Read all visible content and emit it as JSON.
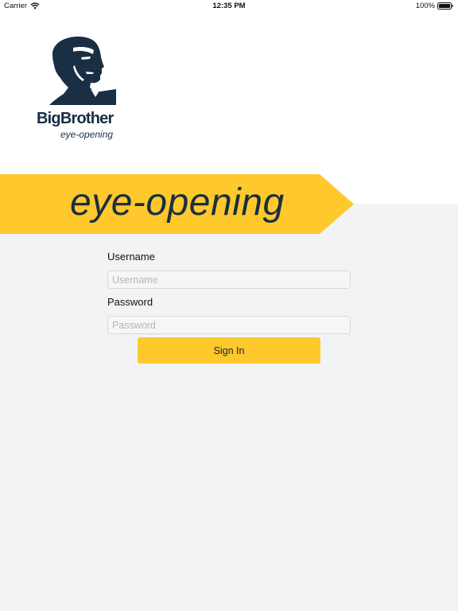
{
  "status_bar": {
    "carrier": "Carrier",
    "time": "12:35 PM",
    "battery": "100%",
    "wifi_icon": "wifi-icon",
    "battery_icon": "battery-icon"
  },
  "logo": {
    "name": "BigBrother",
    "tagline": "eye-opening",
    "color": "#1a2e44"
  },
  "banner": {
    "text": "eye-opening",
    "color": "#ffc92e",
    "text_color": "#1c2e3f"
  },
  "form": {
    "username_label": "Username",
    "username_placeholder": "Username",
    "username_value": "",
    "password_label": "Password",
    "password_placeholder": "Password",
    "password_value": ""
  },
  "signin_button": {
    "label": "Sign In",
    "color": "#ffc92e"
  }
}
